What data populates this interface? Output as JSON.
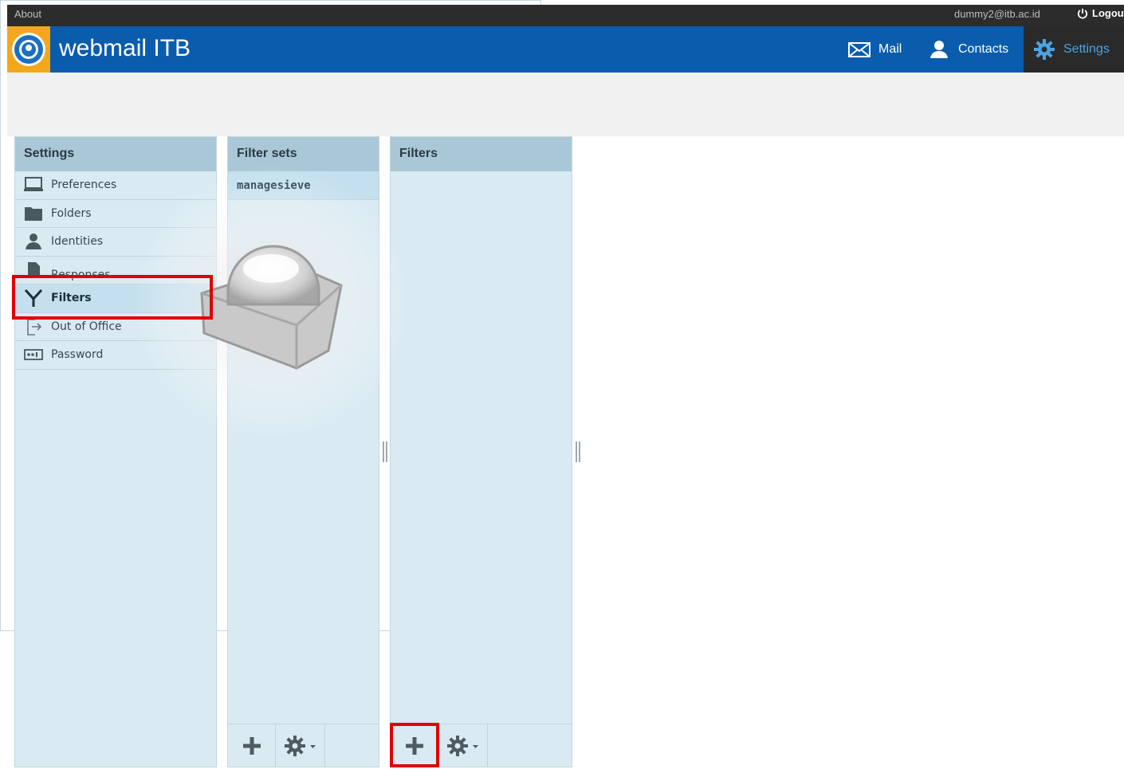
{
  "topbar": {
    "about_label": "About",
    "user_email": "dummy2@itb.ac.id",
    "logout_label": "Logout"
  },
  "header": {
    "app_title": "webmail ITB",
    "nav": {
      "mail_label": "Mail",
      "contacts_label": "Contacts",
      "settings_label": "Settings"
    },
    "colors": {
      "header_bg": "#0a5cad",
      "active_nav_text": "#4aa3e6",
      "logo_bg": "#f4a71c"
    }
  },
  "settings_panel": {
    "title": "Settings",
    "items": [
      {
        "label": "Preferences",
        "icon": "monitor-icon"
      },
      {
        "label": "Folders",
        "icon": "folder-icon"
      },
      {
        "label": "Identities",
        "icon": "person-icon"
      },
      {
        "label": "Responses",
        "icon": "document-icon"
      },
      {
        "label": "Filters",
        "icon": "filter-icon",
        "active": true
      },
      {
        "label": "Out of Office",
        "icon": "out-of-office-icon"
      },
      {
        "label": "Password",
        "icon": "password-icon"
      }
    ]
  },
  "filter_sets_panel": {
    "title": "Filter sets",
    "items": [
      {
        "label": "managesieve",
        "selected": true
      }
    ],
    "footer": {
      "add_icon": "plus-icon",
      "actions_icon": "gear-menu-icon"
    }
  },
  "filters_panel": {
    "title": "Filters",
    "items": [],
    "footer": {
      "add_icon": "plus-icon",
      "actions_icon": "gear-menu-icon"
    }
  },
  "content_panel": {
    "watermark_icon": "roundcube-logo-icon"
  },
  "annotations": {
    "highlight_color": "#e00000",
    "highlighted": [
      "Filters",
      "add-filter-button"
    ]
  }
}
